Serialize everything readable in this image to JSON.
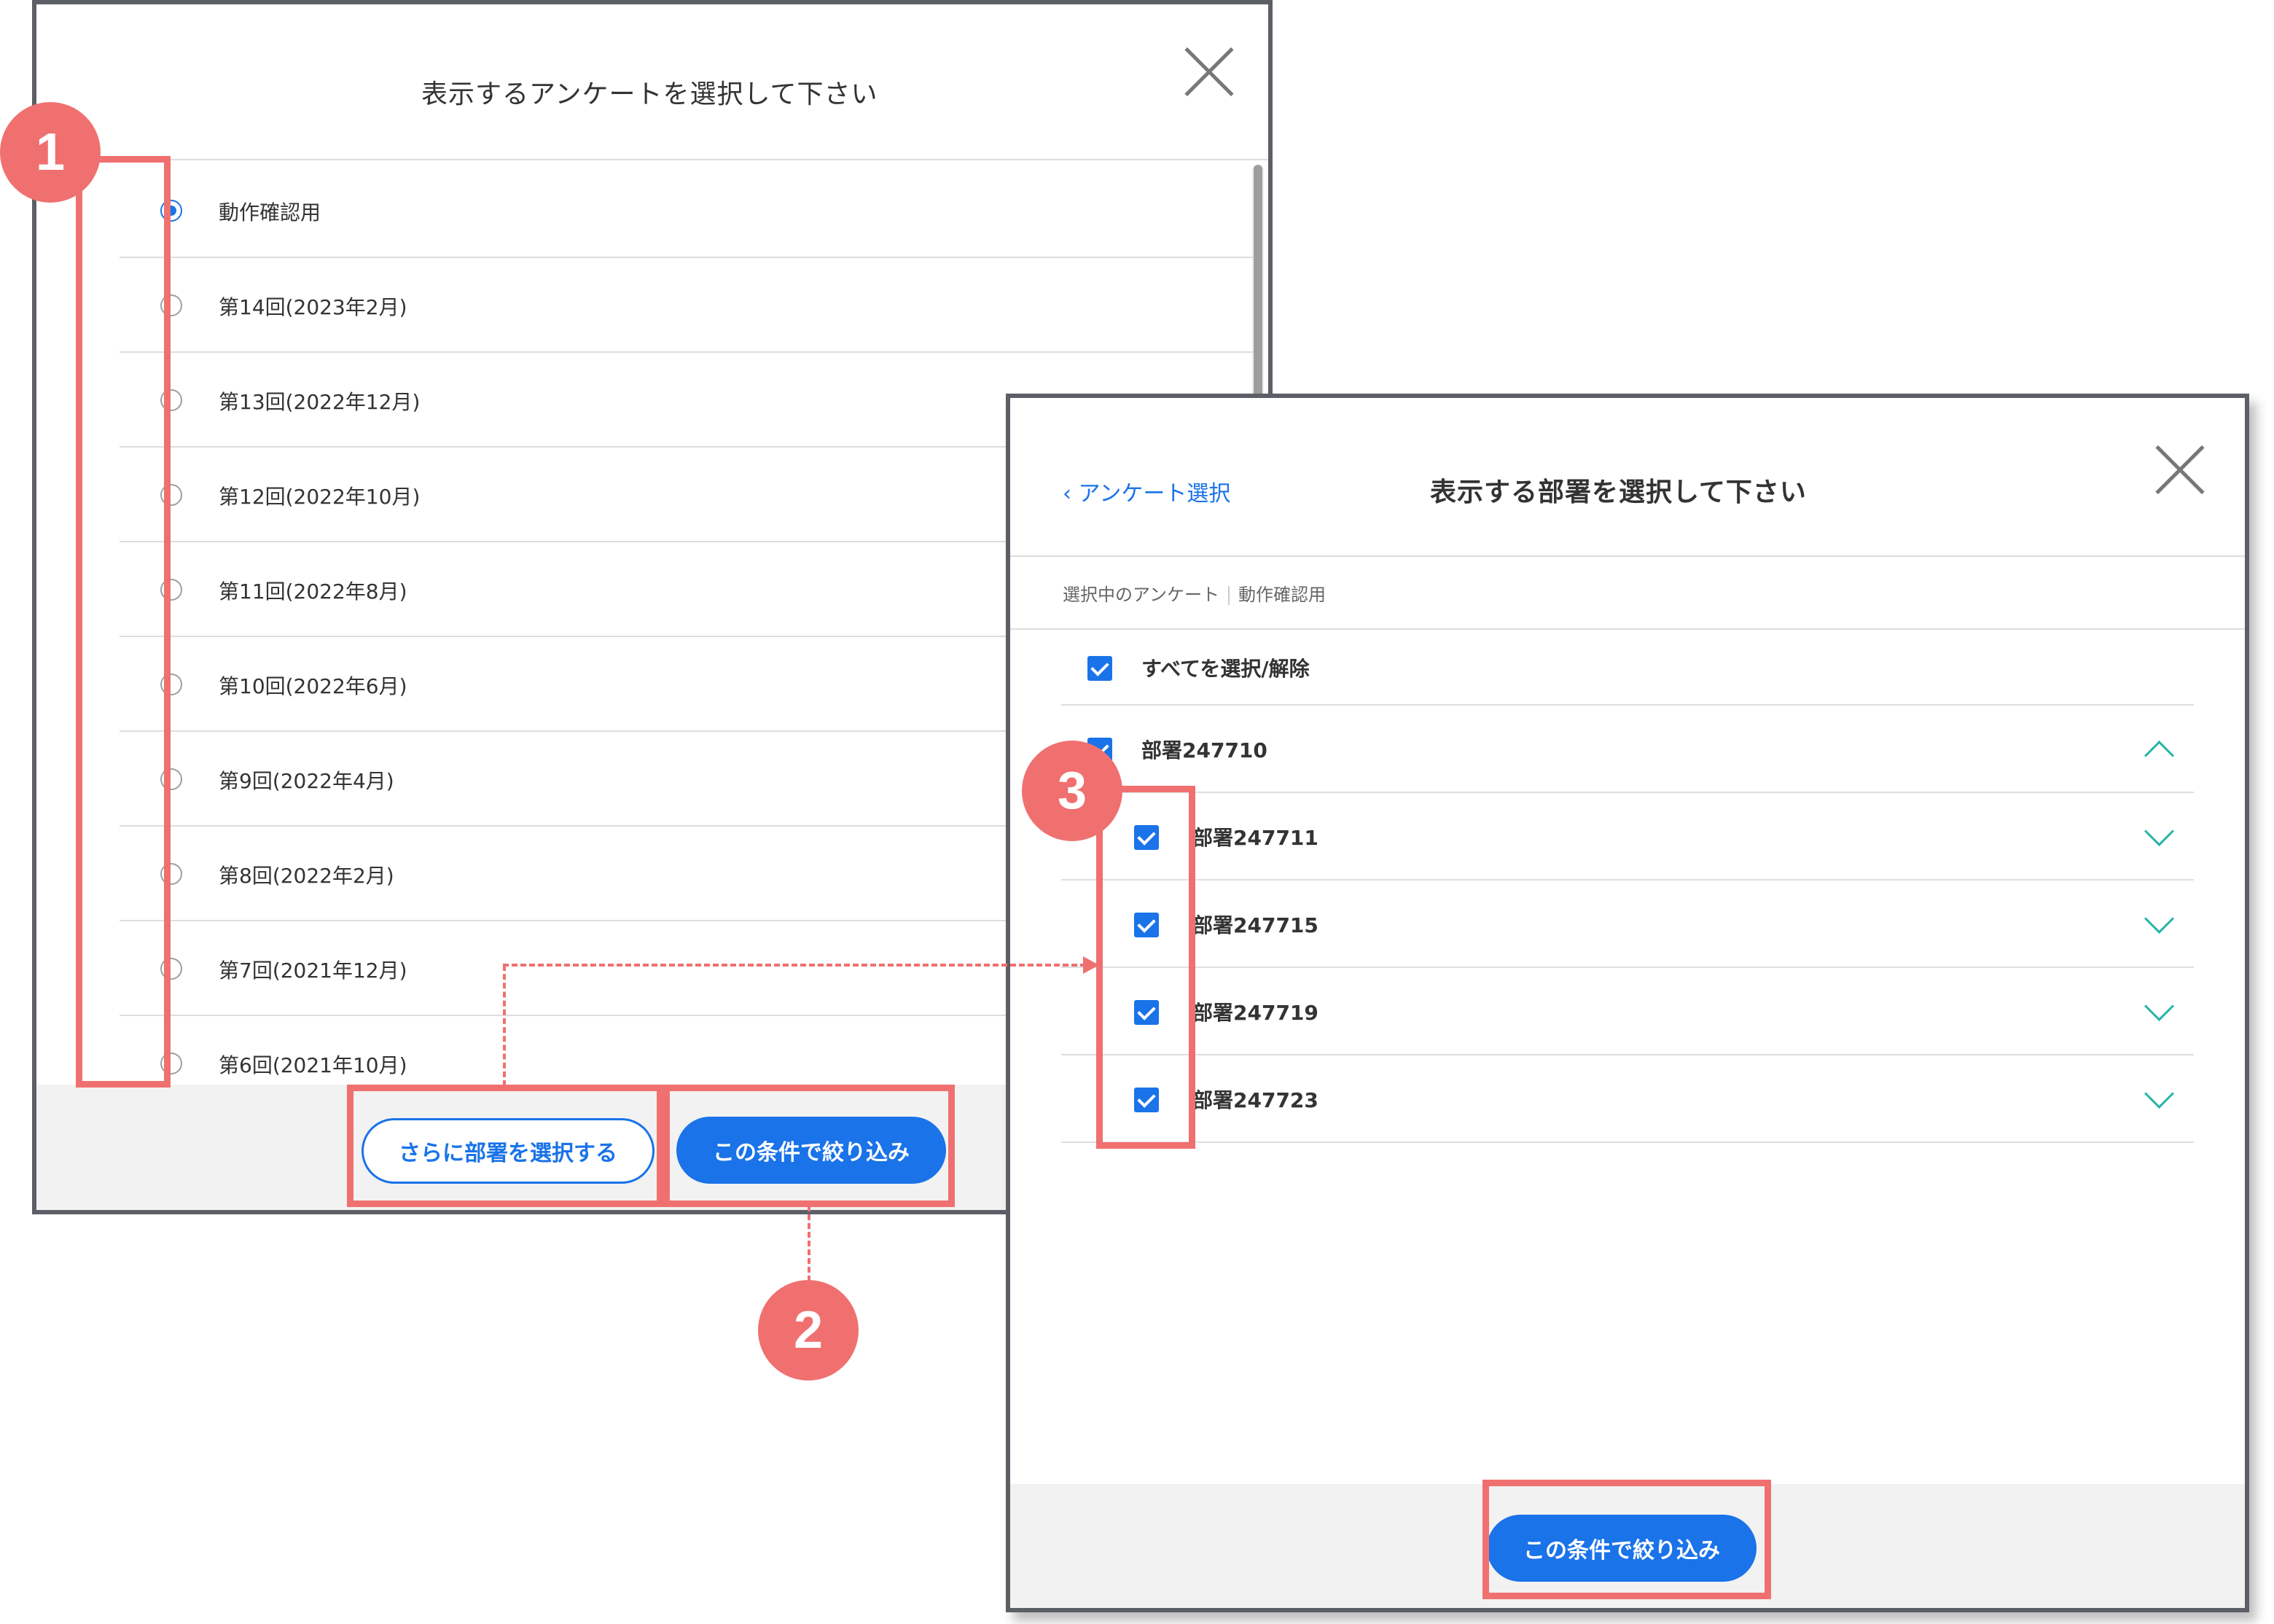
{
  "modal1": {
    "title": "表示するアンケートを選択して下さい",
    "surveys": [
      {
        "label": "動作確認用",
        "selected": true
      },
      {
        "label": "第14回(2023年2月)",
        "selected": false
      },
      {
        "label": "第13回(2022年12月)",
        "selected": false
      },
      {
        "label": "第12回(2022年10月)",
        "selected": false
      },
      {
        "label": "第11回(2022年8月)",
        "selected": false
      },
      {
        "label": "第10回(2022年6月)",
        "selected": false
      },
      {
        "label": "第9回(2022年4月)",
        "selected": false
      },
      {
        "label": "第8回(2022年2月)",
        "selected": false
      },
      {
        "label": "第7回(2021年12月)",
        "selected": false
      },
      {
        "label": "第6回(2021年10月)",
        "selected": false
      }
    ],
    "select_dept_button": "さらに部署を選択する",
    "filter_button": "この条件で絞り込み"
  },
  "modal2": {
    "back_link": "‹ アンケート選択",
    "title": "表示する部署を選択して下さい",
    "selected_label": "選択中のアンケート",
    "selected_value": "動作確認用",
    "select_all": "すべてを選択/解除",
    "departments": [
      {
        "label": "部署247710",
        "checked": true,
        "expanded": true
      },
      {
        "label": "部署247711",
        "checked": true,
        "expanded": false
      },
      {
        "label": "部署247715",
        "checked": true,
        "expanded": false
      },
      {
        "label": "部署247719",
        "checked": true,
        "expanded": false
      },
      {
        "label": "部署247723",
        "checked": true,
        "expanded": false
      }
    ],
    "filter_button": "この条件で絞り込み"
  },
  "annotations": {
    "badge1": "1",
    "badge2": "2",
    "badge3": "3"
  },
  "colors": {
    "accent": "#1a73e8",
    "highlight": "#f07070",
    "chevron": "#26b5a8"
  }
}
